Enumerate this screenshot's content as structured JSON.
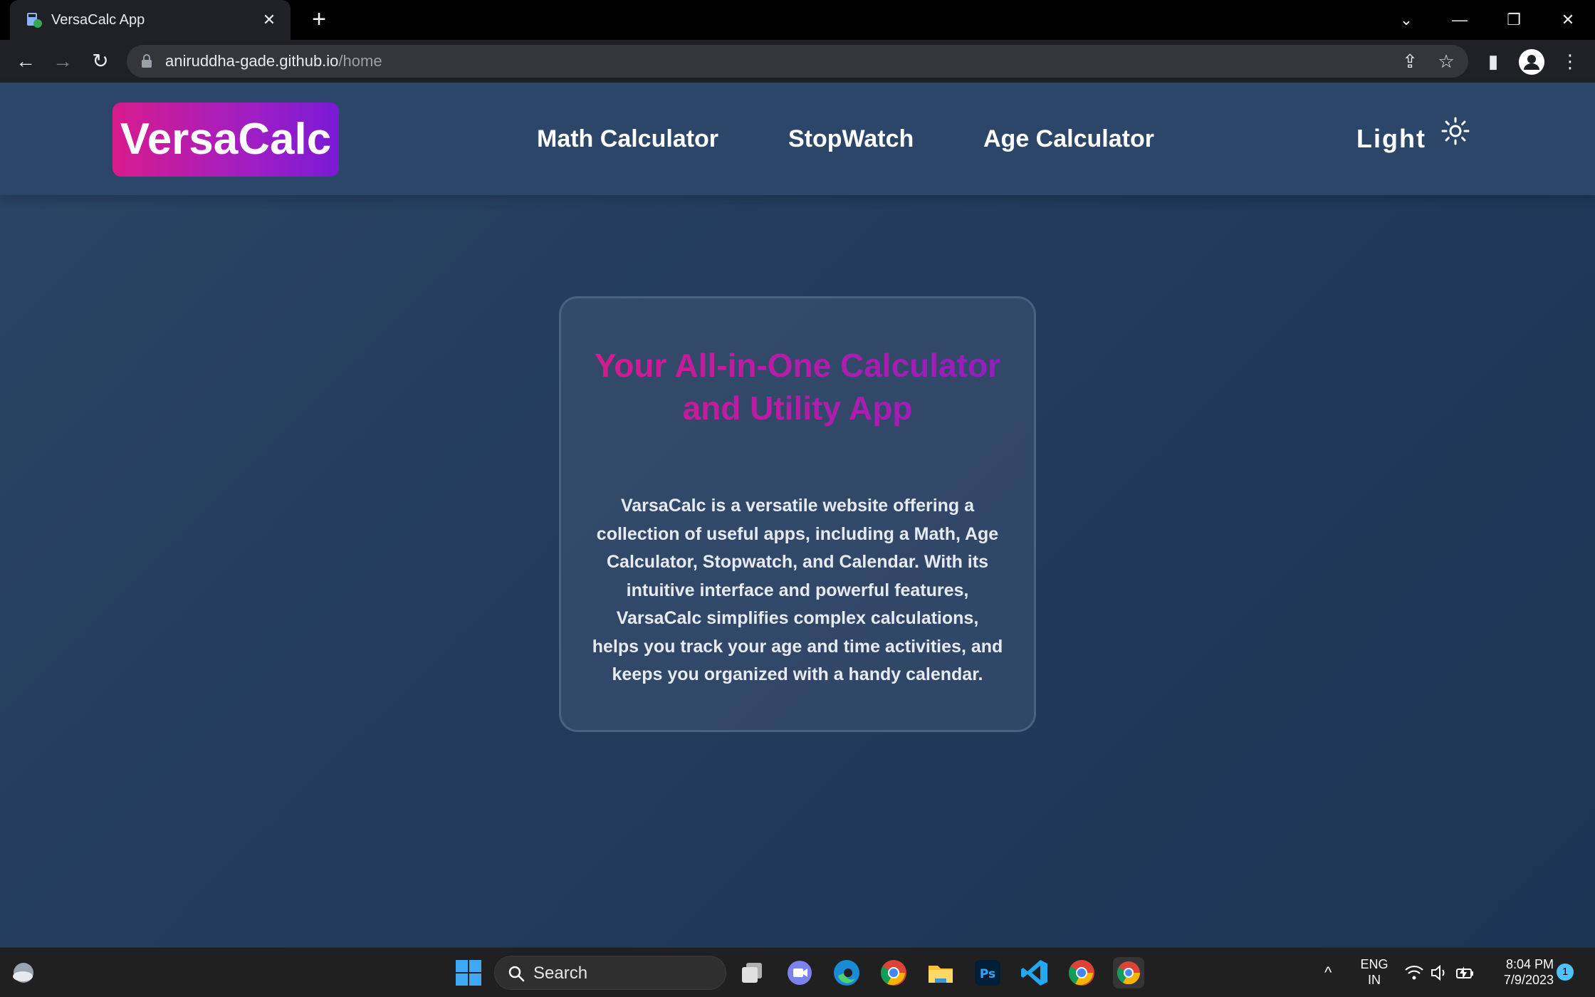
{
  "browser": {
    "tab_title": "VersaCalc App",
    "new_tab": "+",
    "url_host": "aniruddha-gade.github.io",
    "url_path": "/home"
  },
  "site": {
    "logo": "VersaCalc",
    "nav": [
      "Math Calculator",
      "StopWatch",
      "Age Calculator"
    ],
    "theme_label": "Light",
    "card": {
      "title": "Your All-in-One Calculator and Utility App",
      "description": "VarsaCalc is a versatile website offering a collection of useful apps, including a Math, Age Calculator, Stopwatch, and Calendar. With its intuitive interface and powerful features, VarsaCalc simplifies complex calculations, helps you track your age and time activities, and keeps you organized with a handy calendar."
    },
    "colors": {
      "gradient_start": "#d81b8c",
      "gradient_end": "#7a1ad6",
      "background": "#223a5c"
    }
  },
  "taskbar": {
    "search_label": "Search",
    "language_line1": "ENG",
    "language_line2": "IN",
    "time": "8:04 PM",
    "date": "7/9/2023",
    "notification_count": "1"
  }
}
